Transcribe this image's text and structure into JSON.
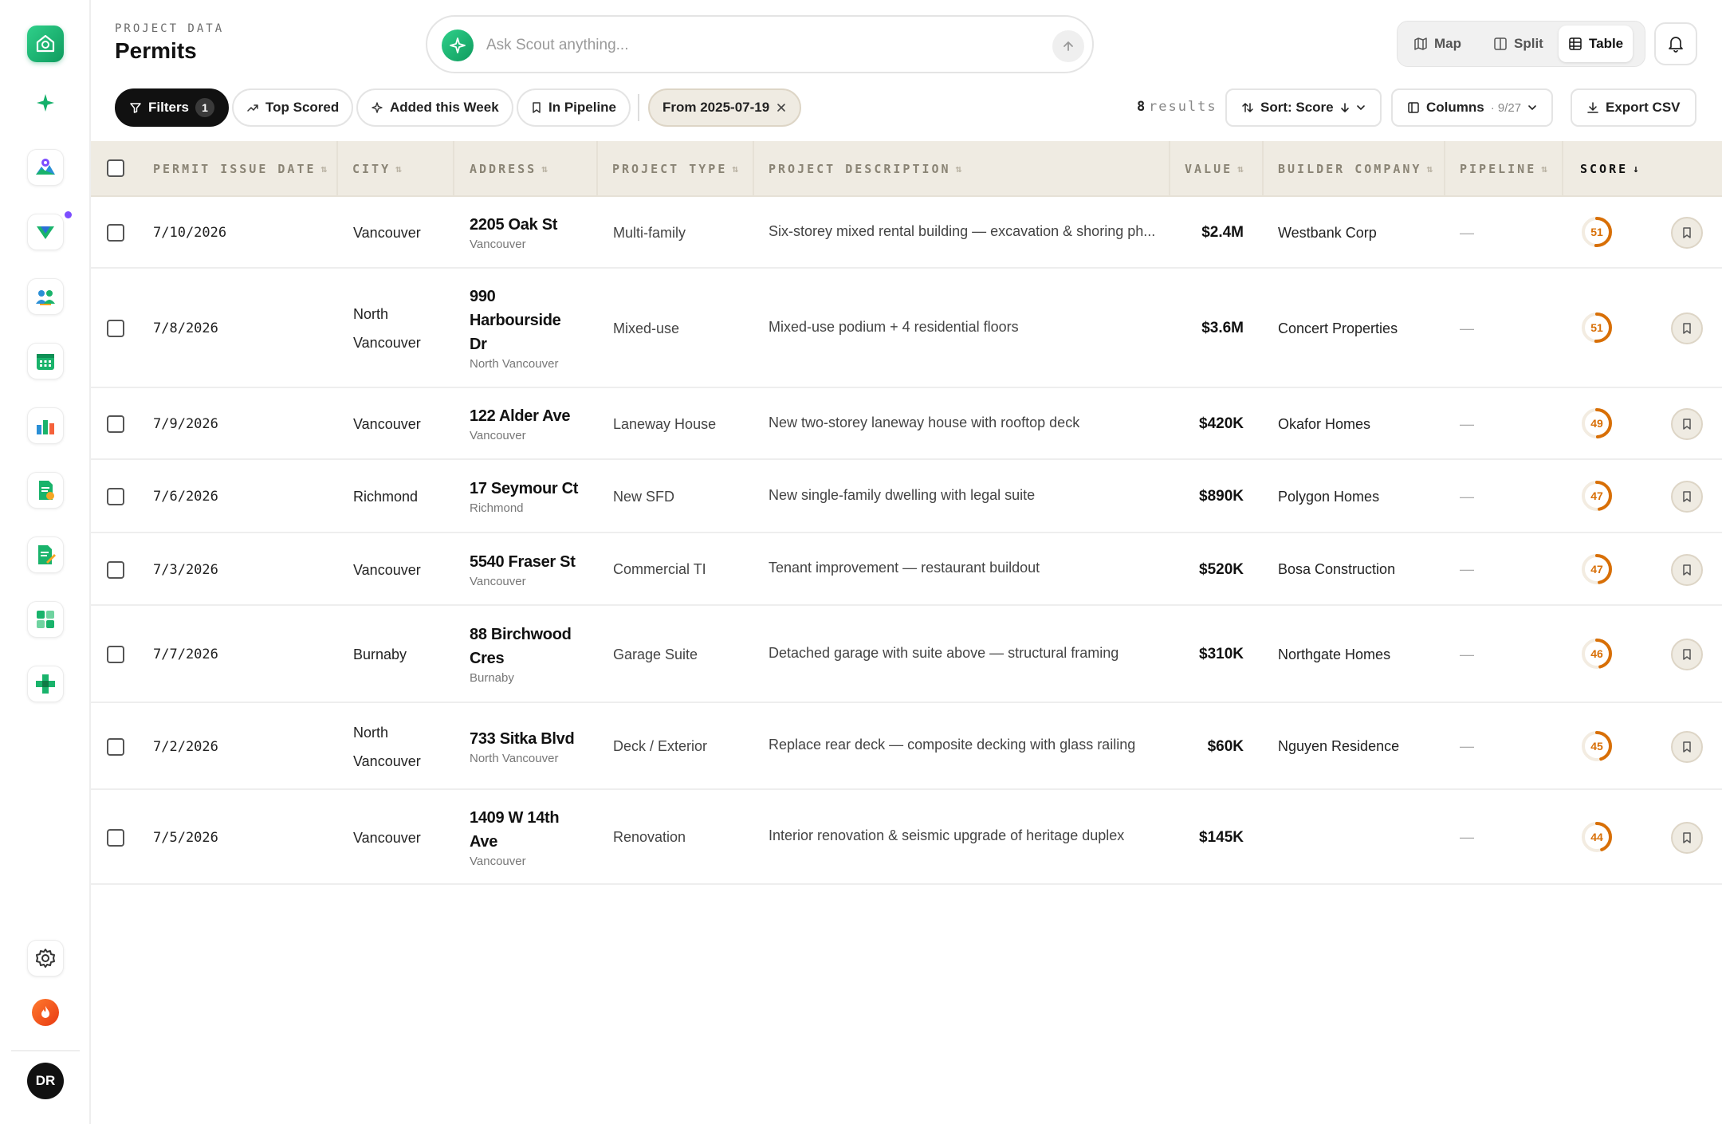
{
  "header": {
    "label": "PROJECT DATA",
    "title": "Permits"
  },
  "search": {
    "placeholder": "Ask Scout anything..."
  },
  "views": [
    {
      "label": "Map",
      "icon": "map-icon"
    },
    {
      "label": "Split",
      "icon": "split-icon"
    },
    {
      "label": "Table",
      "icon": "table-icon",
      "active": true
    }
  ],
  "filters": {
    "label": "Filters",
    "count": "1"
  },
  "quick_filters": [
    {
      "label": "Top Scored",
      "icon": "trending-up-icon"
    },
    {
      "label": "Added this Week",
      "icon": "sparkle-icon"
    },
    {
      "label": "In Pipeline",
      "icon": "bookmark-icon"
    }
  ],
  "date_filter": {
    "label": "From 2025-07-19"
  },
  "results": {
    "count": "8",
    "label": "results"
  },
  "toolbar": {
    "sort_label": "Sort: Score",
    "columns_label": "Columns",
    "columns_count": "· 9/27",
    "export_label": "Export CSV"
  },
  "columns": [
    "PERMIT ISSUE DATE",
    "CITY",
    "ADDRESS",
    "PROJECT TYPE",
    "PROJECT DESCRIPTION",
    "VALUE",
    "BUILDER COMPANY",
    "PIPELINE",
    "SCORE"
  ],
  "sorted_column": "SCORE",
  "accent_color": "#d86f06",
  "brand_color": "#14b06a",
  "rows": [
    {
      "date": "7/10/2026",
      "city": [
        "Vancouver"
      ],
      "address": [
        "2205 Oak St"
      ],
      "addr_city": "Vancouver",
      "type": "Multi-family",
      "desc": "Six-storey mixed rental building — excavation & shoring ph...",
      "value": "$2.4M",
      "builder": "Westbank Corp",
      "pipeline": "—",
      "score": 51
    },
    {
      "date": "7/8/2026",
      "city": [
        "North",
        "Vancouver"
      ],
      "address": [
        "990",
        "Harbourside",
        "Dr"
      ],
      "addr_city": "North Vancouver",
      "type": "Mixed-use",
      "desc": "Mixed-use podium + 4 residential floors",
      "value": "$3.6M",
      "builder": "Concert Properties",
      "pipeline": "—",
      "score": 51
    },
    {
      "date": "7/9/2026",
      "city": [
        "Vancouver"
      ],
      "address": [
        "122 Alder Ave"
      ],
      "addr_city": "Vancouver",
      "type": "Laneway House",
      "desc": "New two-storey laneway house with rooftop deck",
      "value": "$420K",
      "builder": "Okafor Homes",
      "pipeline": "—",
      "score": 49
    },
    {
      "date": "7/6/2026",
      "city": [
        "Richmond"
      ],
      "address": [
        "17 Seymour Ct"
      ],
      "addr_city": "Richmond",
      "type": "New SFD",
      "desc": "New single-family dwelling with legal suite",
      "value": "$890K",
      "builder": "Polygon Homes",
      "pipeline": "—",
      "score": 47
    },
    {
      "date": "7/3/2026",
      "city": [
        "Vancouver"
      ],
      "address": [
        "5540 Fraser St"
      ],
      "addr_city": "Vancouver",
      "type": "Commercial TI",
      "desc": "Tenant improvement — restaurant buildout",
      "value": "$520K",
      "builder": "Bosa Construction",
      "pipeline": "—",
      "score": 47
    },
    {
      "date": "7/7/2026",
      "city": [
        "Burnaby"
      ],
      "address": [
        "88 Birchwood",
        "Cres"
      ],
      "addr_city": "Burnaby",
      "type": "Garage Suite",
      "desc": "Detached garage with suite above — structural framing",
      "value": "$310K",
      "builder": "Northgate Homes",
      "pipeline": "—",
      "score": 46
    },
    {
      "date": "7/2/2026",
      "city": [
        "North",
        "Vancouver"
      ],
      "address": [
        "733 Sitka Blvd"
      ],
      "addr_city": "North Vancouver",
      "type": "Deck / Exterior",
      "desc": "Replace rear deck — composite decking with glass railing",
      "value": "$60K",
      "builder": "Nguyen Residence",
      "pipeline": "—",
      "score": 45
    },
    {
      "date": "7/5/2026",
      "city": [
        "Vancouver"
      ],
      "address": [
        "1409 W 14th",
        "Ave"
      ],
      "addr_city": "Vancouver",
      "type": "Renovation",
      "desc": "Interior renovation & seismic upgrade of heritage duplex",
      "value": "$145K",
      "builder": "",
      "pipeline": "—",
      "score": 44
    }
  ],
  "user": {
    "initials": "DR"
  }
}
